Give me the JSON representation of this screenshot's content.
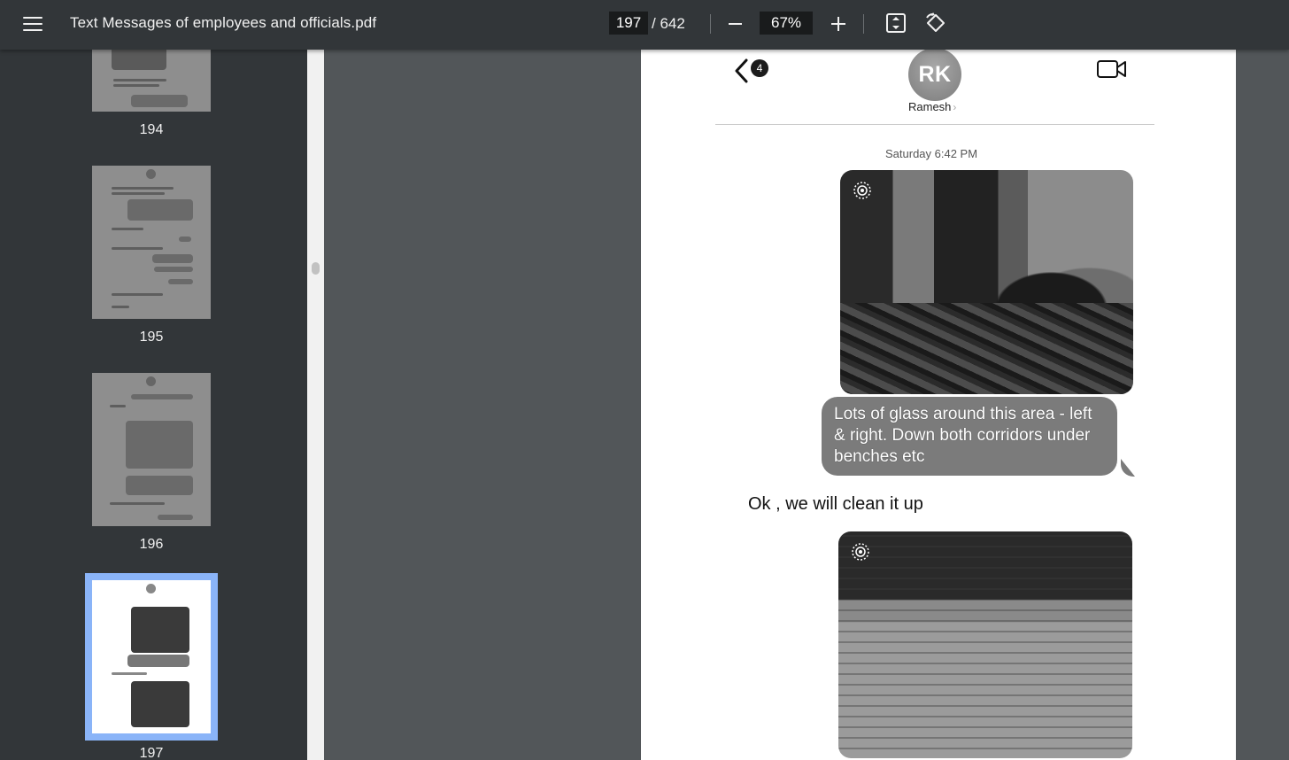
{
  "toolbar": {
    "title": "Text Messages of employees and officials.pdf",
    "current_page": "197",
    "total_pages": "/ 642",
    "zoom": "67%"
  },
  "sidebar": {
    "thumbnails": [
      {
        "label": "194"
      },
      {
        "label": "195"
      },
      {
        "label": "196"
      },
      {
        "label": "197",
        "active": true
      }
    ]
  },
  "page": {
    "badge_count": "4",
    "avatar_initials": "RK",
    "contact_name": "Ramesh",
    "contact_chevron": "›",
    "timestamp": "Saturday 6:42 PM",
    "incoming_message": "Lots of glass around this area - left & right. Down both corridors under benches etc",
    "outgoing_message": "Ok , we will clean it up"
  },
  "icons": {
    "menu": "menu-icon",
    "zoom_out": "minus-icon",
    "zoom_in": "plus-icon",
    "fit": "fit-to-page-icon",
    "rotate": "rotate-icon",
    "back": "chevron-left-icon",
    "video": "video-camera-icon",
    "live_photo": "live-photo-icon"
  },
  "colors": {
    "toolbar_bg": "#323639",
    "viewer_bg": "#525659",
    "active_thumb_outline": "#8ab4f8",
    "bubble_bg": "#7b7b7b"
  }
}
